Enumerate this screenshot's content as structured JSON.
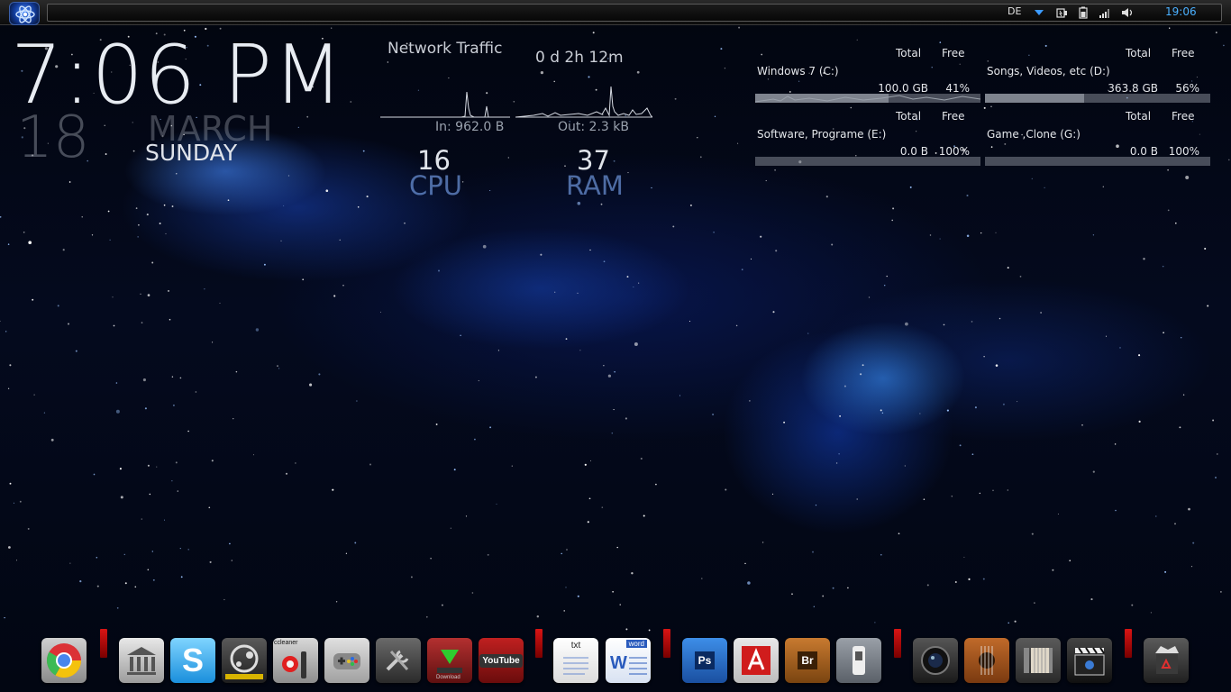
{
  "taskbar": {
    "language": "DE",
    "clock": "19:06",
    "tray_icons": [
      "power-icon",
      "battery-icon",
      "network-signal-icon",
      "volume-icon"
    ]
  },
  "clock_widget": {
    "time": "7:06 PM",
    "day": "18",
    "month": "MARCH",
    "weekday": "SUNDAY"
  },
  "network": {
    "title": "Network Traffic",
    "uptime": "0 d 2h 12m",
    "in_label": "In: 962.0 B",
    "out_label": "Out: 2.3 kB"
  },
  "system": {
    "cpu_value": "16",
    "cpu_label": "CPU",
    "ram_value": "37",
    "ram_label": "RAM",
    "cpu_percent": 16,
    "ram_percent": 37
  },
  "drives": {
    "header_total": "Total",
    "header_free": "Free",
    "items": [
      {
        "name": "Windows 7 (C:)",
        "total": "100.0 GB",
        "free": "41%",
        "free_percent": 41
      },
      {
        "name": "Songs, Videos, etc (D:)",
        "total": "363.8 GB",
        "free": "56%",
        "free_percent": 56
      },
      {
        "name": "Software, Programe (E:)",
        "total": "0.0 B",
        "free": "100%",
        "free_percent": 100
      },
      {
        "name": "Game ,Clone (G:)",
        "total": "0.0 B",
        "free": "100%",
        "free_percent": 100
      }
    ]
  },
  "dock": {
    "photoshop": "Ps",
    "bridge": "Br",
    "text_doc": "txt",
    "word_doc": "word",
    "word_letter": "W",
    "youtube": "YouTube",
    "ccleaner": "ccleaner",
    "download": "Download",
    "icons": [
      "chrome-icon",
      "library-icon",
      "skype-icon",
      "steam-icon",
      "ccleaner-icon",
      "gamepad-icon",
      "tools-icon",
      "download-icon",
      "youtube-icon",
      "text-document-icon",
      "word-document-icon",
      "photoshop-icon",
      "acrobat-icon",
      "bridge-icon",
      "device-icon",
      "camera-icon",
      "guitar-icon",
      "accordion-icon",
      "video-clapper-icon",
      "recycle-bin-icon"
    ]
  },
  "colors": {
    "accent": "#4ab0ff",
    "dock_separator": "#d81414"
  }
}
